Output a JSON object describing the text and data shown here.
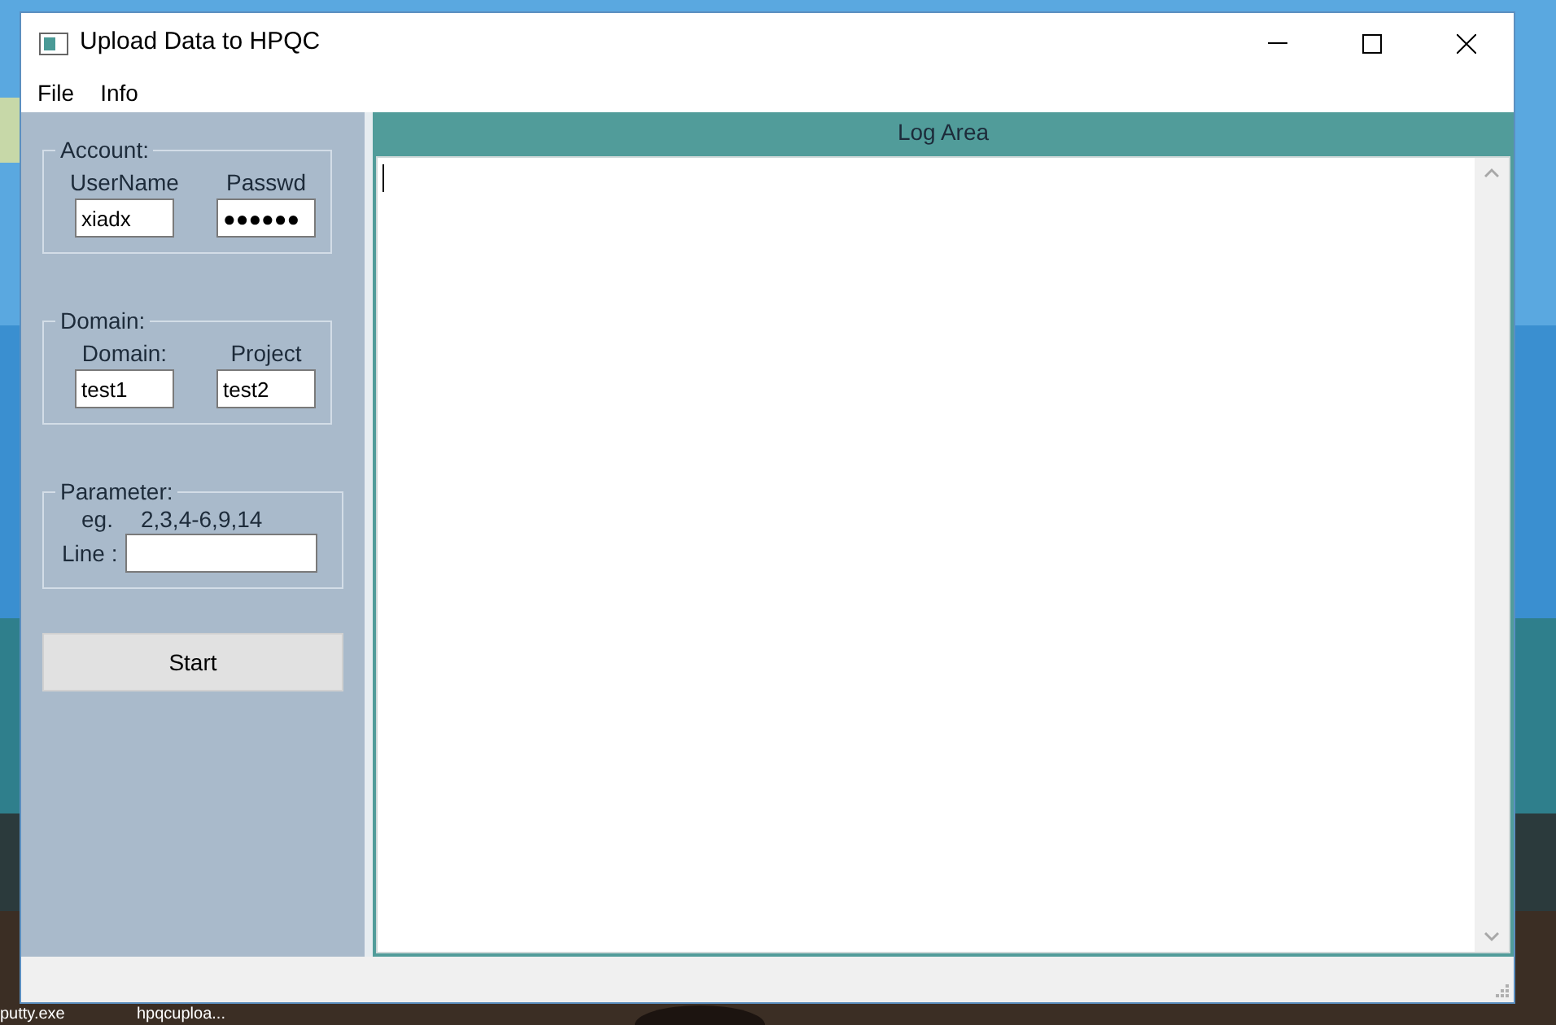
{
  "window": {
    "title": "Upload Data to HPQC"
  },
  "menu": [
    "File",
    "Info"
  ],
  "account": {
    "legend": "Account:",
    "fields": [
      {
        "label": "UserName",
        "value": "xiadx"
      },
      {
        "label": "Passwd",
        "value": "●●●●●●"
      }
    ]
  },
  "domain": {
    "legend": "Domain:",
    "fields": [
      {
        "label": "Domain:",
        "value": "test1"
      },
      {
        "label": "Project",
        "value": "test2"
      }
    ]
  },
  "parameter": {
    "legend": "Parameter:",
    "hint_label": "eg.",
    "hint": "2,3,4-6,9,14",
    "line_label": "Line :"
  },
  "start_button": "Start",
  "log_area": {
    "title": "Log Area"
  },
  "desktop_icons": [
    {
      "label": "putty.exe"
    },
    {
      "label": "hpqcuploa..."
    }
  ]
}
